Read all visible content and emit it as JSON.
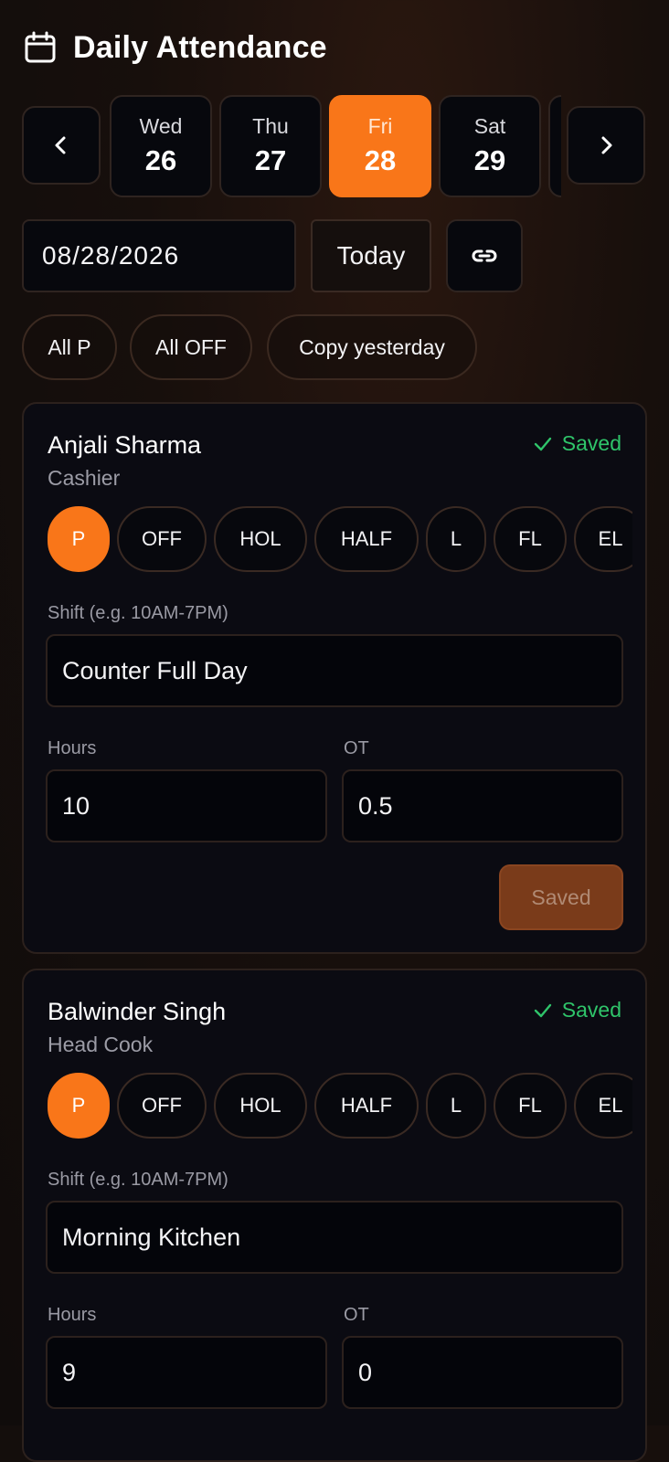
{
  "header": {
    "title": "Daily Attendance",
    "icon": "calendar-icon"
  },
  "date_strip": {
    "days": [
      {
        "name": "Wed",
        "num": "26",
        "active": false
      },
      {
        "name": "Thu",
        "num": "27",
        "active": false
      },
      {
        "name": "Fri",
        "num": "28",
        "active": true
      },
      {
        "name": "Sat",
        "num": "29",
        "active": false
      }
    ]
  },
  "date_row": {
    "date_value": "08/28/2026",
    "today_label": "Today",
    "link_icon": "link-icon"
  },
  "bulk_actions": {
    "all_p": "All P",
    "all_off": "All OFF",
    "copy_yesterday": "Copy yesterday"
  },
  "status_options": [
    "P",
    "OFF",
    "HOL",
    "HALF",
    "L",
    "FL",
    "EL"
  ],
  "labels": {
    "shift": "Shift (e.g. 10AM-7PM)",
    "hours": "Hours",
    "ot": "OT",
    "saved_status": "Saved",
    "save_button": "Saved"
  },
  "employees": [
    {
      "name": "Anjali Sharma",
      "role": "Cashier",
      "selected_status": "P",
      "shift": "Counter Full Day",
      "hours": "10",
      "ot": "0.5"
    },
    {
      "name": "Balwinder Singh",
      "role": "Head Cook",
      "selected_status": "P",
      "shift": "Morning Kitchen",
      "hours": "9",
      "ot": "0"
    }
  ],
  "colors": {
    "accent": "#f97619",
    "saved_green": "#2fc46a",
    "background": "#140e0c"
  }
}
